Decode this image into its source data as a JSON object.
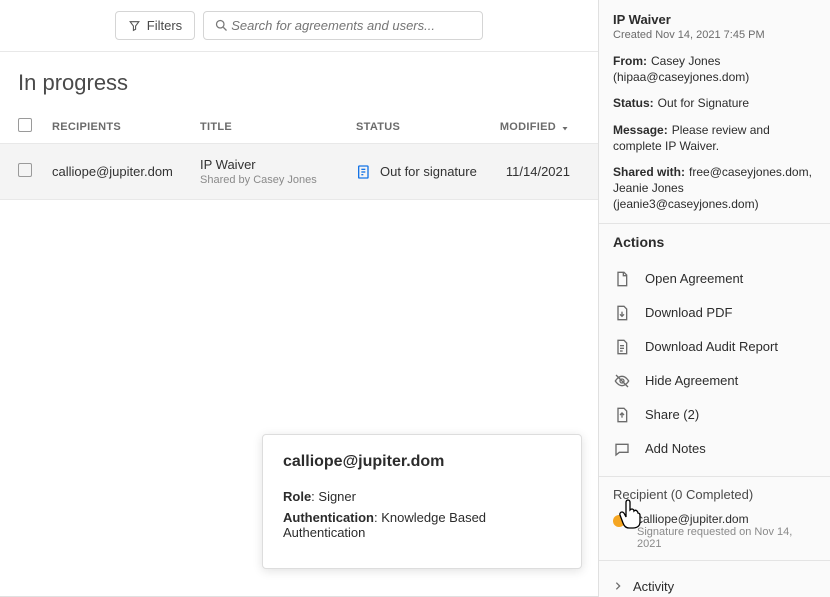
{
  "toolbar": {
    "filters_label": "Filters",
    "search_placeholder": "Search for agreements and users..."
  },
  "heading": "In progress",
  "columns": {
    "recipients": "RECIPIENTS",
    "title": "TITLE",
    "status": "STATUS",
    "modified": "MODIFIED"
  },
  "rows": [
    {
      "recipient": "calliope@jupiter.dom",
      "title": "IP Waiver",
      "subtitle": "Shared by Casey Jones",
      "status": "Out for signature",
      "modified": "11/14/2021"
    }
  ],
  "tooltip": {
    "email": "calliope@jupiter.dom",
    "role_label": "Role",
    "role_value": ": Signer",
    "auth_label": "Authentication",
    "auth_value": ": Knowledge Based Authentication"
  },
  "side": {
    "title": "IP Waiver",
    "created": "Created Nov 14, 2021 7:45 PM",
    "from_label": "From:",
    "from_value": "Casey Jones (hipaa@caseyjones.dom)",
    "status_label": "Status:",
    "status_value": "Out for Signature",
    "message_label": "Message:",
    "message_value": "Please review and complete IP Waiver.",
    "shared_label": "Shared with:",
    "shared_value": "free@caseyjones.dom, Jeanie Jones (jeanie3@caseyjones.dom)",
    "actions_heading": "Actions",
    "actions": {
      "open": "Open Agreement",
      "download_pdf": "Download PDF",
      "download_audit": "Download Audit Report",
      "hide": "Hide Agreement",
      "share": "Share (2)",
      "notes": "Add Notes"
    },
    "recipient_heading": "Recipient (0 Completed)",
    "recipient_name": "calliope@jupiter.dom",
    "recipient_sub": "Signature requested on Nov 14, 2021",
    "activity": "Activity"
  }
}
